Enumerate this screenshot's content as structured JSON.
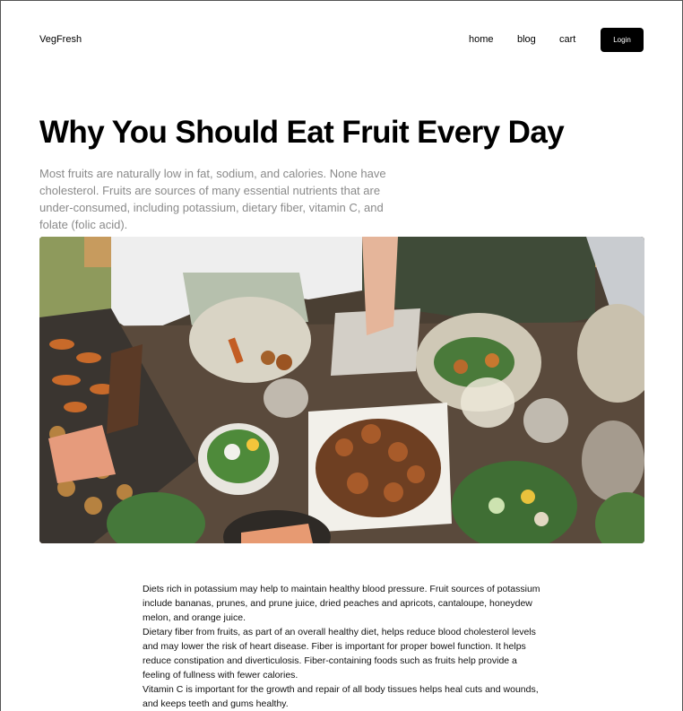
{
  "header": {
    "brand": "VegFresh",
    "nav": [
      "home",
      "blog",
      "cart"
    ],
    "login_label": "Login"
  },
  "article": {
    "title": "Why You Should Eat Fruit Every Day",
    "intro": "Most fruits are naturally low in fat, sodium, and calories. None have cholesterol. Fruits are sources of many essential nutrients that are under-consumed, including potassium, dietary fiber, vitamin C, and folate (folic acid).",
    "paragraphs": [
      "Diets rich in potassium may help to maintain healthy blood pressure. Fruit sources of potassium include bananas, prunes, and prune juice, dried peaches and apricots, cantaloupe, honeydew melon, and orange juice.",
      "Dietary fiber from fruits, as part of an overall healthy diet, helps reduce blood cholesterol levels and may lower the risk of heart disease. Fiber is important for proper bowel function. It helps reduce constipation and diverticulosis. Fiber-containing foods such as fruits help provide a feeling of fullness with fewer calories.",
      "Vitamin C is important for the growth and repair of all body tissues helps heal cuts and wounds, and keeps teeth and gums healthy."
    ]
  },
  "icons": {
    "hero": "hero-photo-table-feast"
  },
  "colors": {
    "text": "#000000",
    "intro_text": "#8a8a8a",
    "button_bg": "#000000",
    "button_text": "#ffffff"
  }
}
